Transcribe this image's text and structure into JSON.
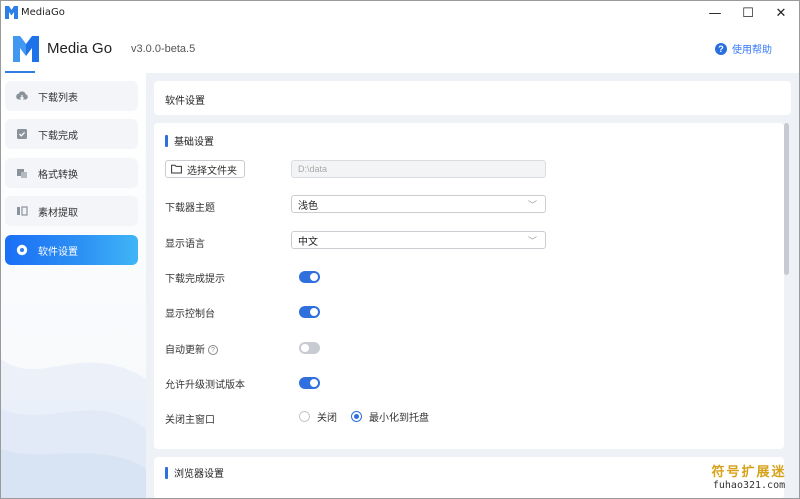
{
  "window": {
    "title": "MediaGo",
    "minimize_symbol": "—",
    "maximize_symbol": "☐",
    "close_symbol": "✕"
  },
  "header": {
    "brand": "Media Go",
    "version": "v3.0.0-beta.5",
    "help_label": "使用帮助",
    "help_symbol": "?"
  },
  "sidebar": {
    "items": [
      {
        "label": "下载列表",
        "icon": "cloud-download-icon",
        "active": false
      },
      {
        "label": "下载完成",
        "icon": "check-square-icon",
        "active": false
      },
      {
        "label": "格式转换",
        "icon": "convert-icon",
        "active": false
      },
      {
        "label": "素材提取",
        "icon": "extract-icon",
        "active": false
      },
      {
        "label": "软件设置",
        "icon": "settings-icon",
        "active": true
      }
    ]
  },
  "page": {
    "title": "软件设置"
  },
  "basic": {
    "section_title": "基础设置",
    "folder_button": "选择文件夹",
    "folder_path_placeholder": "D:\\data",
    "theme_label": "下载器主题",
    "theme_value": "浅色",
    "language_label": "显示语言",
    "language_value": "中文",
    "complete_tip_label": "下载完成提示",
    "complete_tip_on": true,
    "console_label": "显示控制台",
    "console_on": true,
    "auto_update_label": "自动更新",
    "auto_update_on": false,
    "beta_label": "允许升级测试版本",
    "beta_on": true,
    "close_window_label": "关闭主窗口",
    "close_options": [
      {
        "label": "关闭",
        "checked": false
      },
      {
        "label": "最小化到托盘",
        "checked": true
      }
    ]
  },
  "browser": {
    "section_title": "浏览器设置"
  },
  "watermark": {
    "line1": "符号扩展迷",
    "line2": "fuhao321.com"
  },
  "colors": {
    "accent": "#2f6fde",
    "active_nav_start": "#1a6ff5",
    "active_nav_end": "#3fb6f7",
    "main_bg": "#eef2f7",
    "help_link": "#3478f6",
    "watermark": "#d6a21a"
  }
}
